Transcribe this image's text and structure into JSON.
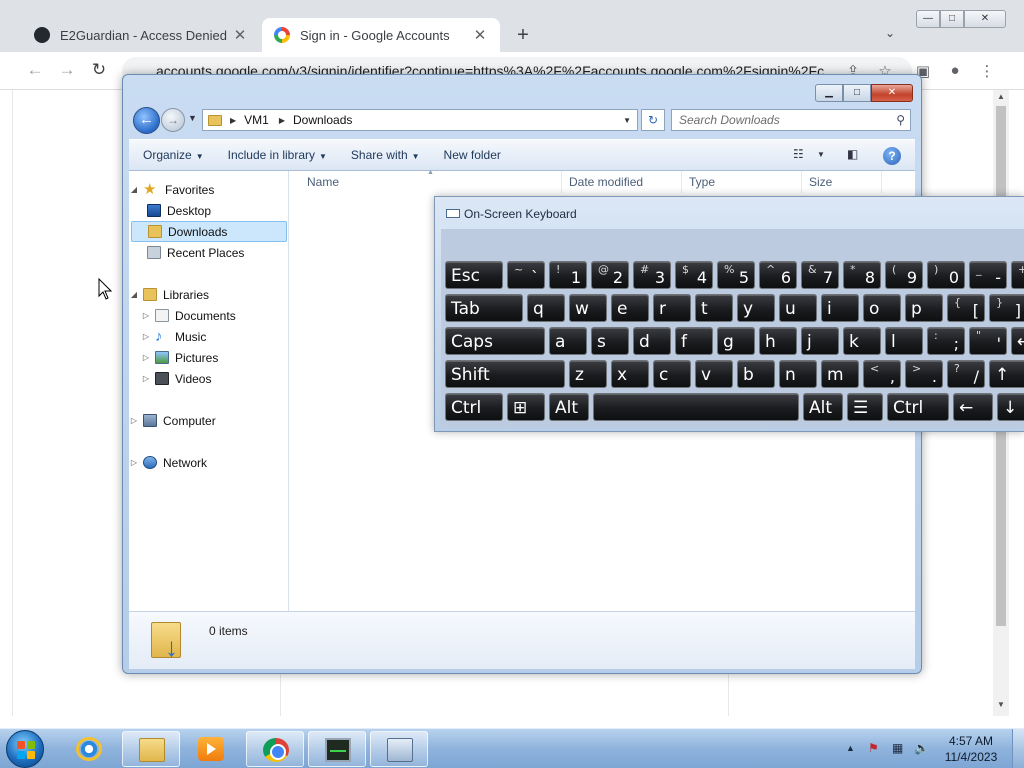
{
  "browser": {
    "tabs": [
      {
        "title": "E2Guardian - Access Denied",
        "close": "✕",
        "favicon": "github-icon"
      },
      {
        "title": "Sign in - Google Accounts",
        "close": "✕",
        "favicon": "google-icon"
      }
    ],
    "new_tab": "+",
    "tab_search": "⌄",
    "url": "accounts.google.com/v3/signin/identifier?continue=https%3A%2F%2Faccounts.google.com%2Fsignin%2Fc",
    "nav": {
      "back": "←",
      "forward": "→",
      "reload": "↻"
    },
    "toolbar_icons": {
      "share": "⇪",
      "bookmark": "☆",
      "side_panel": "▣",
      "profile": "●",
      "menu": "⋮"
    },
    "window_controls": {
      "minimize": "—",
      "maximize": "□",
      "close": "✕"
    }
  },
  "explorer": {
    "window_controls": {
      "minimize": "▁",
      "maximize": "□",
      "close": "✕"
    },
    "breadcrumb": [
      "VM1",
      "Downloads"
    ],
    "search_placeholder": "Search Downloads",
    "commands": {
      "organize": "Organize",
      "include_in_library": "Include in library",
      "share_with": "Share with",
      "new_folder": "New folder"
    },
    "nav_pane": {
      "favorites": "Favorites",
      "desktop": "Desktop",
      "downloads": "Downloads",
      "recent_places": "Recent Places",
      "libraries": "Libraries",
      "documents": "Documents",
      "music": "Music",
      "pictures": "Pictures",
      "videos": "Videos",
      "computer": "Computer",
      "network": "Network"
    },
    "columns": [
      "Name",
      "Date modified",
      "Type",
      "Size"
    ],
    "status": "0 items"
  },
  "osk": {
    "title": "On-Screen Keyboard",
    "rows": [
      [
        {
          "label": "Esc"
        },
        {
          "top": "~",
          "bot": "`"
        },
        {
          "top": "!",
          "bot": "1"
        },
        {
          "top": "@",
          "bot": "2"
        },
        {
          "top": "#",
          "bot": "3"
        },
        {
          "top": "$",
          "bot": "4"
        },
        {
          "top": "%",
          "bot": "5"
        },
        {
          "top": "^",
          "bot": "6"
        },
        {
          "top": "&",
          "bot": "7"
        },
        {
          "top": "*",
          "bot": "8"
        },
        {
          "top": "(",
          "bot": "9"
        },
        {
          "top": ")",
          "bot": "0"
        },
        {
          "top": "_",
          "bot": "-"
        },
        {
          "top": "+",
          "bot": "="
        }
      ],
      [
        {
          "label": "Tab"
        },
        {
          "main": "q"
        },
        {
          "main": "w"
        },
        {
          "main": "e"
        },
        {
          "main": "r"
        },
        {
          "main": "t"
        },
        {
          "main": "y"
        },
        {
          "main": "u"
        },
        {
          "main": "i"
        },
        {
          "main": "o"
        },
        {
          "main": "p"
        },
        {
          "top": "{",
          "bot": "["
        },
        {
          "top": "}",
          "bot": "]"
        }
      ],
      [
        {
          "label": "Caps"
        },
        {
          "main": "a"
        },
        {
          "main": "s"
        },
        {
          "main": "d"
        },
        {
          "main": "f"
        },
        {
          "main": "g"
        },
        {
          "main": "h"
        },
        {
          "main": "j"
        },
        {
          "main": "k"
        },
        {
          "main": "l"
        },
        {
          "top": ":",
          "bot": ";"
        },
        {
          "top": "\"",
          "bot": "'"
        },
        {
          "label": "↵"
        }
      ],
      [
        {
          "label": "Shift"
        },
        {
          "main": "z"
        },
        {
          "main": "x"
        },
        {
          "main": "c"
        },
        {
          "main": "v"
        },
        {
          "main": "b"
        },
        {
          "main": "n"
        },
        {
          "main": "m"
        },
        {
          "top": "<",
          "bot": ","
        },
        {
          "top": ">",
          "bot": "."
        },
        {
          "top": "?",
          "bot": "/"
        },
        {
          "label": "↑"
        }
      ],
      [
        {
          "label": "Ctrl"
        },
        {
          "label": "⊞"
        },
        {
          "label": "Alt"
        },
        {
          "label": ""
        },
        {
          "label": "Alt"
        },
        {
          "label": "☰"
        },
        {
          "label": "Ctrl"
        },
        {
          "label": "←"
        },
        {
          "label": "↓"
        }
      ]
    ]
  },
  "taskbar": {
    "apps": [
      "start-button",
      "internet-explorer",
      "windows-explorer",
      "media-player",
      "google-chrome",
      "task-manager",
      "on-screen-keyboard"
    ],
    "tray": {
      "show_hidden": "▲",
      "flag": "⚑",
      "network": "▦",
      "volume": "🔈"
    },
    "time": "4:57 AM",
    "date": "11/4/2023"
  }
}
